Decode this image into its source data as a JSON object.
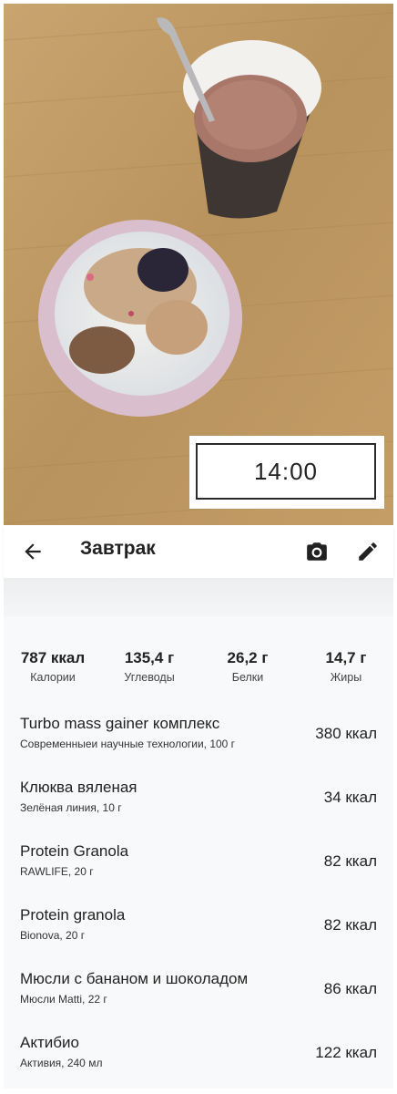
{
  "photo": {
    "time": "14:00"
  },
  "header": {
    "back_icon": "arrow-left-icon",
    "title": "Завтрак",
    "camera_icon": "camera-icon",
    "edit_icon": "pencil-icon"
  },
  "summary": {
    "calories": {
      "value": "787 ккал",
      "label": "Калории"
    },
    "carbs": {
      "value": "135,4 г",
      "label": "Углеводы"
    },
    "protein": {
      "value": "26,2 г",
      "label": "Белки"
    },
    "fat": {
      "value": "14,7 г",
      "label": "Жиры"
    }
  },
  "items": [
    {
      "name": "Turbo mass gainer комплекс",
      "detail": "Современныеи научные технологии, 100 г",
      "kcal": "380 ккал"
    },
    {
      "name": "Клюква вяленая",
      "detail": "Зелёная линия, 10 г",
      "kcal": "34 ккал"
    },
    {
      "name": "Protein Granola",
      "detail": "RAWLIFE, 20 г",
      "kcal": "82 ккал"
    },
    {
      "name": "Protein granola",
      "detail": "Bionova, 20 г",
      "kcal": "82 ккал"
    },
    {
      "name": "Мюсли с бананом и шоколадом",
      "detail": "Мюсли Matti, 22 г",
      "kcal": "86 ккал"
    },
    {
      "name": "Актибио",
      "detail": "Активия, 240 мл",
      "kcal": "122 ккал"
    }
  ]
}
